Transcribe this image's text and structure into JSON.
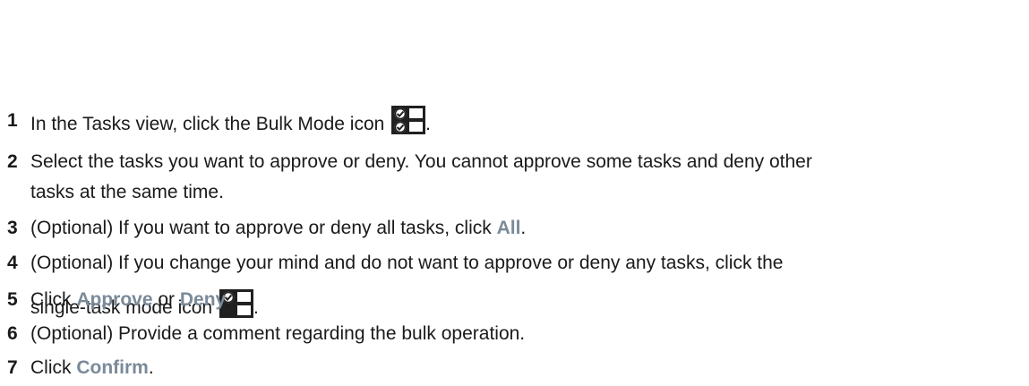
{
  "steps": [
    {
      "number": "1",
      "text_before": "In the Tasks view, click the Bulk Mode icon",
      "icon": "bulk-mode-icon",
      "text_after": "."
    },
    {
      "number": "2",
      "line1": "Select the tasks you want to approve or deny. You cannot approve some tasks and deny other",
      "line2": "tasks at the same time."
    },
    {
      "number": "3",
      "text_before": "(Optional) If you want to approve or deny all tasks, click ",
      "term": "All",
      "text_after": "."
    },
    {
      "number": "4",
      "line1": "(Optional) If you change your mind and do not want to approve or deny any tasks, click the",
      "line2_before": "single-task mode icon",
      "icon": "single-task-mode-icon",
      "line2_after": "."
    },
    {
      "number": "5",
      "text_before": "Click ",
      "term1": "Approve",
      "middle": " or ",
      "term2": "Deny",
      "text_after": "."
    },
    {
      "number": "6",
      "text": "(Optional) Provide a comment regarding the bulk operation."
    },
    {
      "number": "7",
      "text_before": "Click ",
      "term": "Confirm",
      "text_after": "."
    }
  ],
  "colors": {
    "ui_term": "#7a8a99",
    "icon_background": "#202020"
  }
}
